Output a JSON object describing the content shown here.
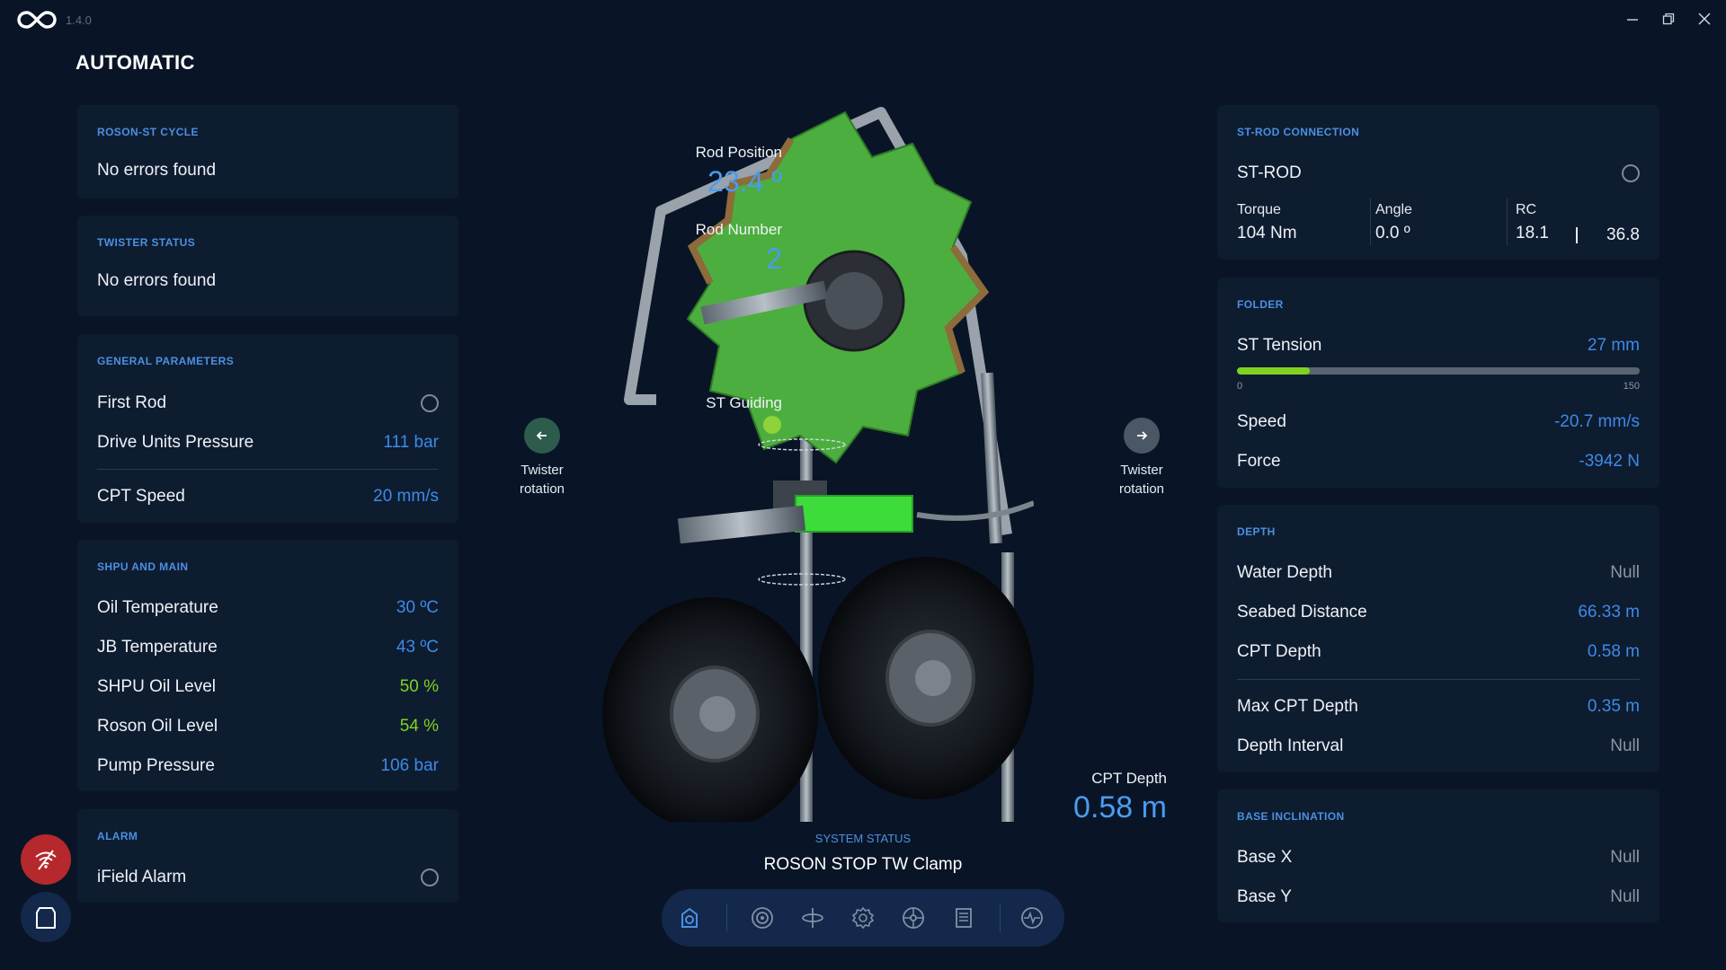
{
  "app": {
    "version": "1.4.0",
    "mode_title": "AUTOMATIC"
  },
  "colors": {
    "accent": "#4a90e2",
    "value_blue": "#3d8ae8",
    "ok_green": "#7ed321",
    "alarm_red": "#b5282c",
    "panel_bg": "#0e1c30",
    "page_bg": "#091526"
  },
  "left": {
    "cycle": {
      "title": "ROSON-ST CYCLE",
      "message": "No errors found"
    },
    "twister": {
      "title": "TWISTER STATUS",
      "message": "No errors found"
    },
    "general": {
      "title": "GENERAL PARAMETERS",
      "first_rod_label": "First Rod",
      "drive_pressure_label": "Drive Units Pressure",
      "drive_pressure_value": "111 bar",
      "cpt_speed_label": "CPT Speed",
      "cpt_speed_value": "20 mm/s"
    },
    "shpu": {
      "title": "SHPU AND MAIN",
      "items": [
        {
          "label": "Oil Temperature",
          "value": "30 ºC"
        },
        {
          "label": "JB Temperature",
          "value": "43 ºC"
        },
        {
          "label": "SHPU Oil Level",
          "value": "50 %"
        },
        {
          "label": "Roson Oil Level",
          "value": "54 %"
        },
        {
          "label": "Pump Pressure",
          "value": "106 bar"
        }
      ]
    },
    "alarm": {
      "title": "ALARM",
      "label": "iField Alarm"
    }
  },
  "center": {
    "rod_position_label": "Rod Position",
    "rod_position_value": "23.4 º",
    "rod_number_label": "Rod Number",
    "rod_number_value": "2",
    "st_guiding_label": "ST Guiding",
    "twister_left_label_1": "Twister",
    "twister_left_label_2": "rotation",
    "twister_right_label_1": "Twister",
    "twister_right_label_2": "rotation",
    "cpt_depth_label": "CPT Depth",
    "cpt_depth_value": "0.58 m",
    "system_status_title": "SYSTEM STATUS",
    "system_status_value": "ROSON STOP TW Clamp"
  },
  "right": {
    "st_rod": {
      "title": "ST-ROD CONNECTION",
      "name": "ST-ROD",
      "torque_label": "Torque",
      "torque_value": "104 Nm",
      "angle_label": "Angle",
      "angle_value": "0.0 º",
      "rc_label": "RC",
      "rc_value_1": "18.1",
      "rc_value_2": "36.8"
    },
    "folder": {
      "title": "FOLDER",
      "tension_label": "ST Tension",
      "tension_value": "27 mm",
      "tension_fraction": 0.18,
      "scale_min": "0",
      "scale_max": "150",
      "speed_label": "Speed",
      "speed_value": "-20.7 mm/s",
      "force_label": "Force",
      "force_value": "-3942 N"
    },
    "depth": {
      "title": "DEPTH",
      "items": [
        {
          "label": "Water Depth",
          "value": "Null"
        },
        {
          "label": "Seabed Distance",
          "value": "66.33 m"
        },
        {
          "label": "CPT Depth",
          "value": "0.58 m"
        },
        {
          "label": "Max CPT Depth",
          "value": "0.35 m"
        },
        {
          "label": "Depth Interval",
          "value": "Null"
        }
      ]
    },
    "base": {
      "title": "BASE INCLINATION",
      "items": [
        {
          "label": "Base X",
          "value": "Null"
        },
        {
          "label": "Base Y",
          "value": "Null"
        }
      ]
    }
  },
  "toolbar_icons": [
    "roson-icon",
    "target-icon",
    "twister-icon",
    "gear-icon",
    "wheel-icon",
    "log-icon",
    "heartbeat-icon"
  ]
}
